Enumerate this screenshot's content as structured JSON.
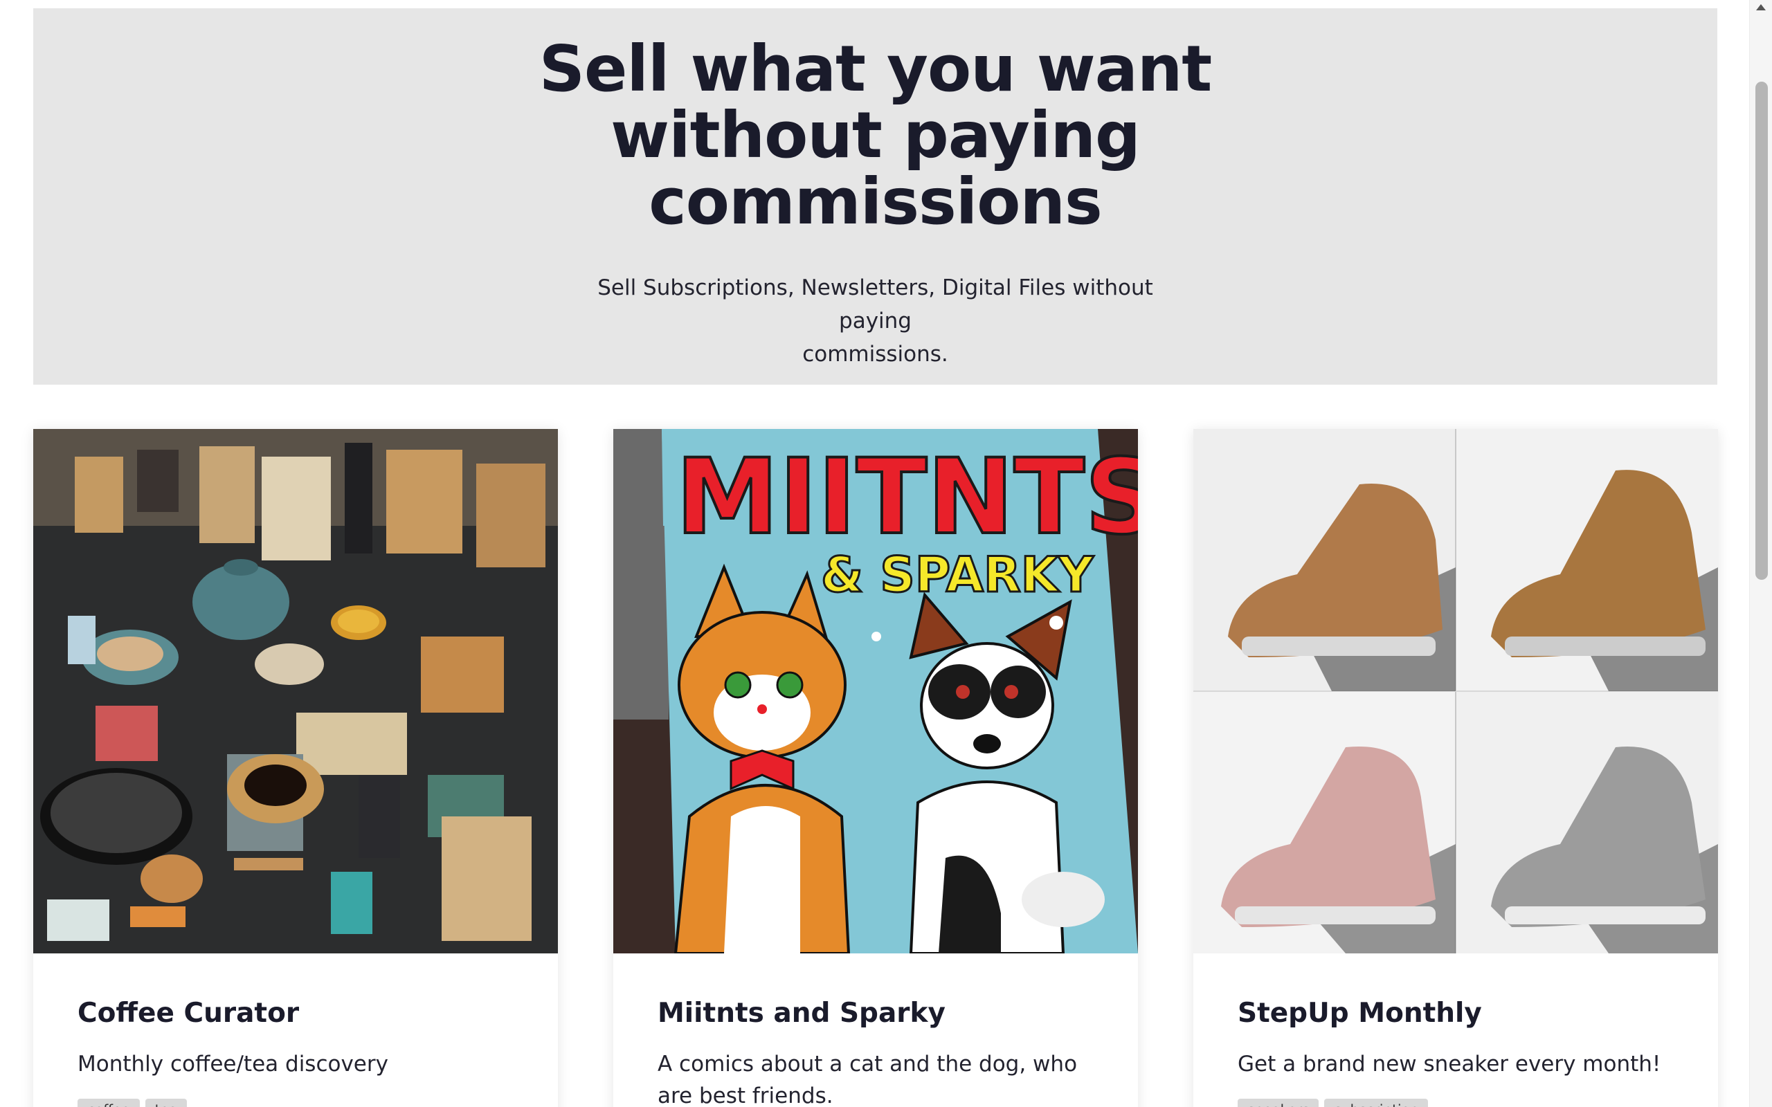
{
  "hero": {
    "title_line1": "Sell what you want",
    "title_line2": "without paying",
    "title_line3": "commissions",
    "subtitle_line1": "Sell Subscriptions, Newsletters, Digital Files without paying",
    "subtitle_line2": "commissions."
  },
  "cards": [
    {
      "title": "Coffee Curator",
      "description": "Monthly coffee/tea discovery",
      "tags": [
        "coffee",
        "tea"
      ],
      "image_icon": "coffee-products-image"
    },
    {
      "title": "Miitnts and Sparky",
      "description": "A comics about a cat and the dog, who are best friends.",
      "image_icon": "comic-cover-image",
      "cover_title": "MIITNTS",
      "cover_subtitle": "& SPARKY"
    },
    {
      "title": "StepUp Monthly",
      "description": "Get a brand new sneaker every month!",
      "tags": [
        "sneakers",
        "subscription"
      ],
      "image_icon": "sneakers-image"
    }
  ],
  "colors": {
    "hero_bg": "#e6e6e6",
    "text_dark": "#1a1b2b",
    "comic_red": "#e8202a",
    "comic_yellow": "#f5e82a",
    "comic_sky": "#7cc3d6"
  }
}
